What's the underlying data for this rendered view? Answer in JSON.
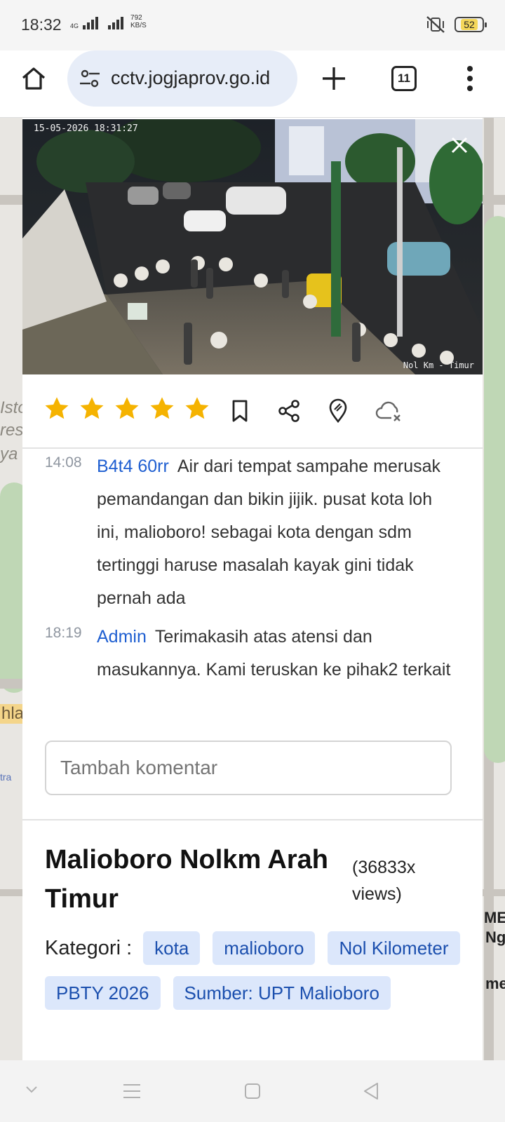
{
  "status": {
    "time": "18:32",
    "network": "4G",
    "speed_value": "792",
    "speed_unit": "KB/S",
    "battery": "52"
  },
  "browser": {
    "url": "cctv.jogjaprov.go.id",
    "tab_count": "11"
  },
  "map": {
    "labels": [
      "Isto",
      "res",
      "ya",
      "hla",
      "tra",
      "ME",
      "Ng",
      "me"
    ]
  },
  "cctv": {
    "timestamp": "15-05-2026 18:31:27",
    "camera_label": "Nol Km - Timur"
  },
  "rating": {
    "value": 5,
    "max": 5
  },
  "comments": [
    {
      "time": "14:08",
      "user": "B4t4 60rr",
      "text": "Air dari tempat sampahe merusak pemandangan dan bikin jijik. pusat kota loh ini, malioboro! sebagai kota dengan sdm tertinggi haruse masalah kayak gini tidak pernah ada"
    },
    {
      "time": "18:19",
      "user": "Admin",
      "text": "Terimakasih atas atensi dan masukannya. Kami teruskan ke pihak2 terkait"
    }
  ],
  "comment_input": {
    "placeholder": "Tambah komentar"
  },
  "info": {
    "title": "Malioboro Nolkm Arah Timur",
    "views": "(36833x views)",
    "category_label": "Kategori :",
    "tags": [
      "kota",
      "malioboro",
      "Nol Kilometer",
      "PBTY 2026",
      "Sumber: UPT Malioboro"
    ]
  },
  "colors": {
    "star": "#f5b301",
    "link": "#1f5fd1",
    "tag_bg": "#dce7fb",
    "tag_text": "#1b4fae"
  }
}
